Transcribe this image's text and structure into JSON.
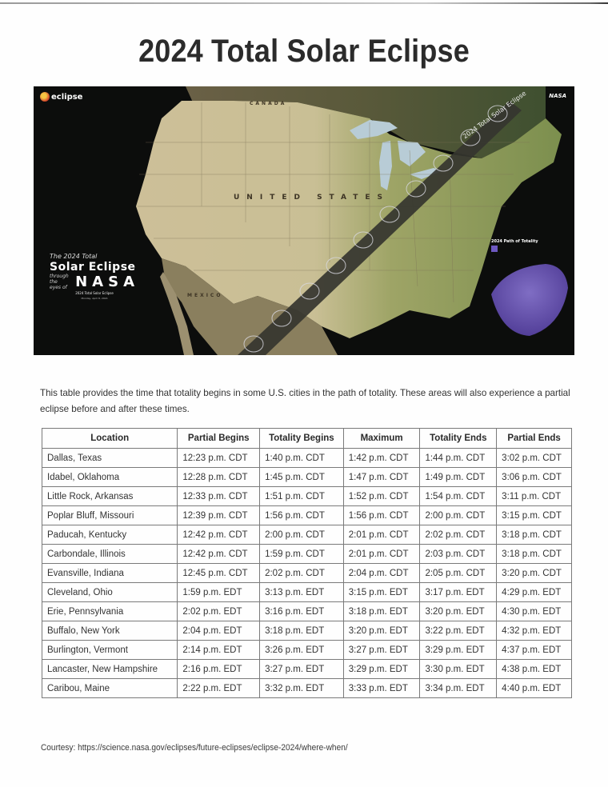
{
  "page": {
    "title": "2024 Total Solar Eclipse"
  },
  "map": {
    "logo_text": "eclipse",
    "agency_logo": "NASA",
    "promo": {
      "line1": "The 2024 Total",
      "line2": "Solar Eclipse",
      "line3a": "through the",
      "line3b": "eyes of",
      "line4": "NASA",
      "caption": "2024 Total Solar Eclipse",
      "caption_date": "Monday, April 8, 2024"
    },
    "labels": {
      "canada": "CANADA",
      "united_states": "UNITED STATES",
      "mexico": "MEXICO",
      "path": "2024 Total Solar Eclipse",
      "inset_title": "2024 Path of Totality"
    },
    "colors": {
      "ocean": "#0c0d0c",
      "land_west": "#cbbd97",
      "land_east": "#8f9a5a",
      "path_band": "#3a3a34",
      "inset_globe": "#7a62c4"
    }
  },
  "intro": "This table provides the time that totality begins in some U.S. cities in the path of totality. These areas will also experience a partial eclipse before and after these times.",
  "table": {
    "headers": [
      "Location",
      "Partial Begins",
      "Totality Begins",
      "Maximum",
      "Totality Ends",
      "Partial Ends"
    ],
    "rows": [
      [
        "Dallas, Texas",
        "12:23 p.m. CDT",
        "1:40 p.m. CDT",
        "1:42 p.m. CDT",
        "1:44 p.m. CDT",
        "3:02 p.m. CDT"
      ],
      [
        "Idabel, Oklahoma",
        "12:28 p.m. CDT",
        "1:45 p.m. CDT",
        "1:47 p.m. CDT",
        "1:49 p.m. CDT",
        "3:06 p.m. CDT"
      ],
      [
        "Little Rock, Arkansas",
        "12:33 p.m. CDT",
        "1:51 p.m. CDT",
        "1:52 p.m. CDT",
        "1:54 p.m. CDT",
        "3:11 p.m. CDT"
      ],
      [
        "Poplar Bluff, Missouri",
        "12:39 p.m. CDT",
        "1:56 p.m. CDT",
        "1:56 p.m. CDT",
        "2:00 p.m. CDT",
        "3:15 p.m. CDT"
      ],
      [
        "Paducah, Kentucky",
        "12:42 p.m. CDT",
        "2:00 p.m. CDT",
        "2:01 p.m. CDT",
        "2:02 p.m. CDT",
        "3:18 p.m. CDT"
      ],
      [
        "Carbondale, Illinois",
        "12:42 p.m. CDT",
        "1:59 p.m. CDT",
        "2:01 p.m. CDT",
        "2:03 p.m. CDT",
        "3:18 p.m. CDT"
      ],
      [
        "Evansville, Indiana",
        "12:45 p.m. CDT",
        "2:02 p.m. CDT",
        "2:04 p.m. CDT",
        "2:05 p.m. CDT",
        "3:20 p.m. CDT"
      ],
      [
        "Cleveland, Ohio",
        "1:59 p.m. EDT",
        "3:13 p.m. EDT",
        "3:15 p.m. EDT",
        "3:17 p.m. EDT",
        "4:29 p.m. EDT"
      ],
      [
        "Erie, Pennsylvania",
        "2:02 p.m. EDT",
        "3:16 p.m. EDT",
        "3:18 p.m. EDT",
        "3:20 p.m. EDT",
        "4:30 p.m. EDT"
      ],
      [
        "Buffalo, New York",
        "2:04 p.m. EDT",
        "3:18 p.m. EDT",
        "3:20 p.m. EDT",
        "3:22 p.m. EDT",
        "4:32 p.m. EDT"
      ],
      [
        "Burlington, Vermont",
        "2:14 p.m. EDT",
        "3:26 p.m. EDT",
        "3:27 p.m. EDT",
        "3:29 p.m. EDT",
        "4:37 p.m. EDT"
      ],
      [
        "Lancaster, New Hampshire",
        "2:16 p.m. EDT",
        "3:27 p.m. EDT",
        "3:29 p.m. EDT",
        "3:30 p.m. EDT",
        "4:38 p.m. EDT"
      ],
      [
        "Caribou, Maine",
        "2:22 p.m. EDT",
        "3:32 p.m. EDT",
        "3:33 p.m. EDT",
        "3:34 p.m. EDT",
        "4:40 p.m. EDT"
      ]
    ]
  },
  "courtesy": "Courtesy: https://science.nasa.gov/eclipses/future-eclipses/eclipse-2024/where-when/"
}
